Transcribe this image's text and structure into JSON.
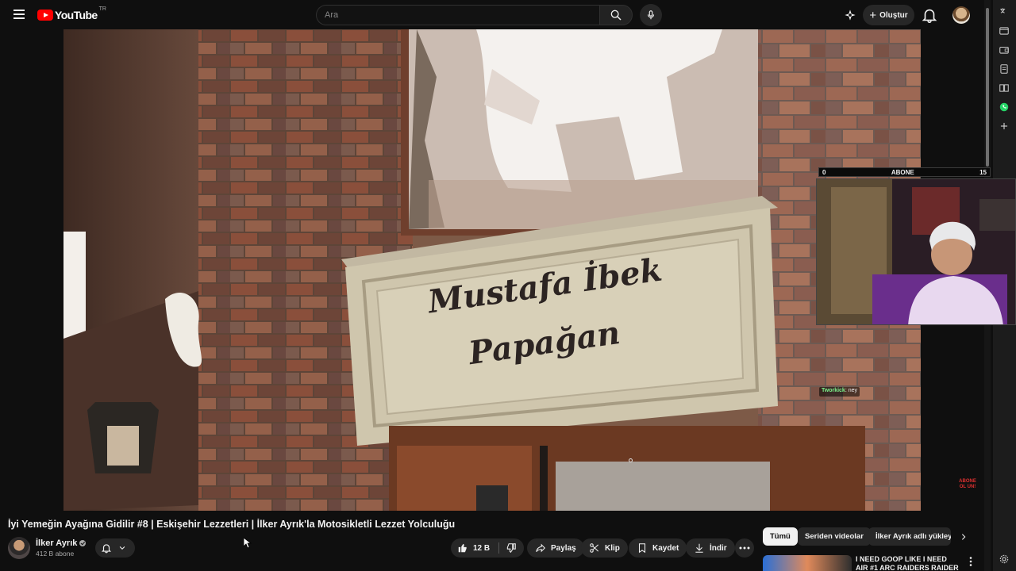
{
  "header": {
    "logo_text": "YouTube",
    "logo_country": "TR",
    "search_placeholder": "Ara",
    "create_label": "Oluştur"
  },
  "overlay": {
    "left_count": "0",
    "label": "ABONE",
    "right_count": "15",
    "chat_user": "Tworkick",
    "chat_message": ": ney",
    "badge_line1": "ABONE",
    "badge_line2": "OL UN!"
  },
  "sign": {
    "line1": "Mustafa İbek",
    "line2": "Papağan"
  },
  "video": {
    "title": "İyi Yemeğin Ayağına Gidilir #8 | Eskişehir Lezzetleri | İlker Ayrık'la Motosikletli Lezzet Yolculuğu",
    "channel_name": "İlker Ayrık",
    "subscribers": "412 B abone",
    "likes": "12 B",
    "share_label": "Paylaş",
    "clip_label": "Klip",
    "save_label": "Kaydet",
    "download_label": "İndir"
  },
  "chips": [
    "Tümü",
    "Seriden videolar",
    "İlker Ayrık adlı yükleyi"
  ],
  "recommendation": {
    "title": "I NEED GOOP LIKE I NEED AIR #1 ARC RAIDERS RAIDER"
  },
  "colors": {
    "background": "#0f0f0f",
    "pill": "#272727",
    "brand": "#ff0000",
    "accent_green": "#25d366"
  }
}
